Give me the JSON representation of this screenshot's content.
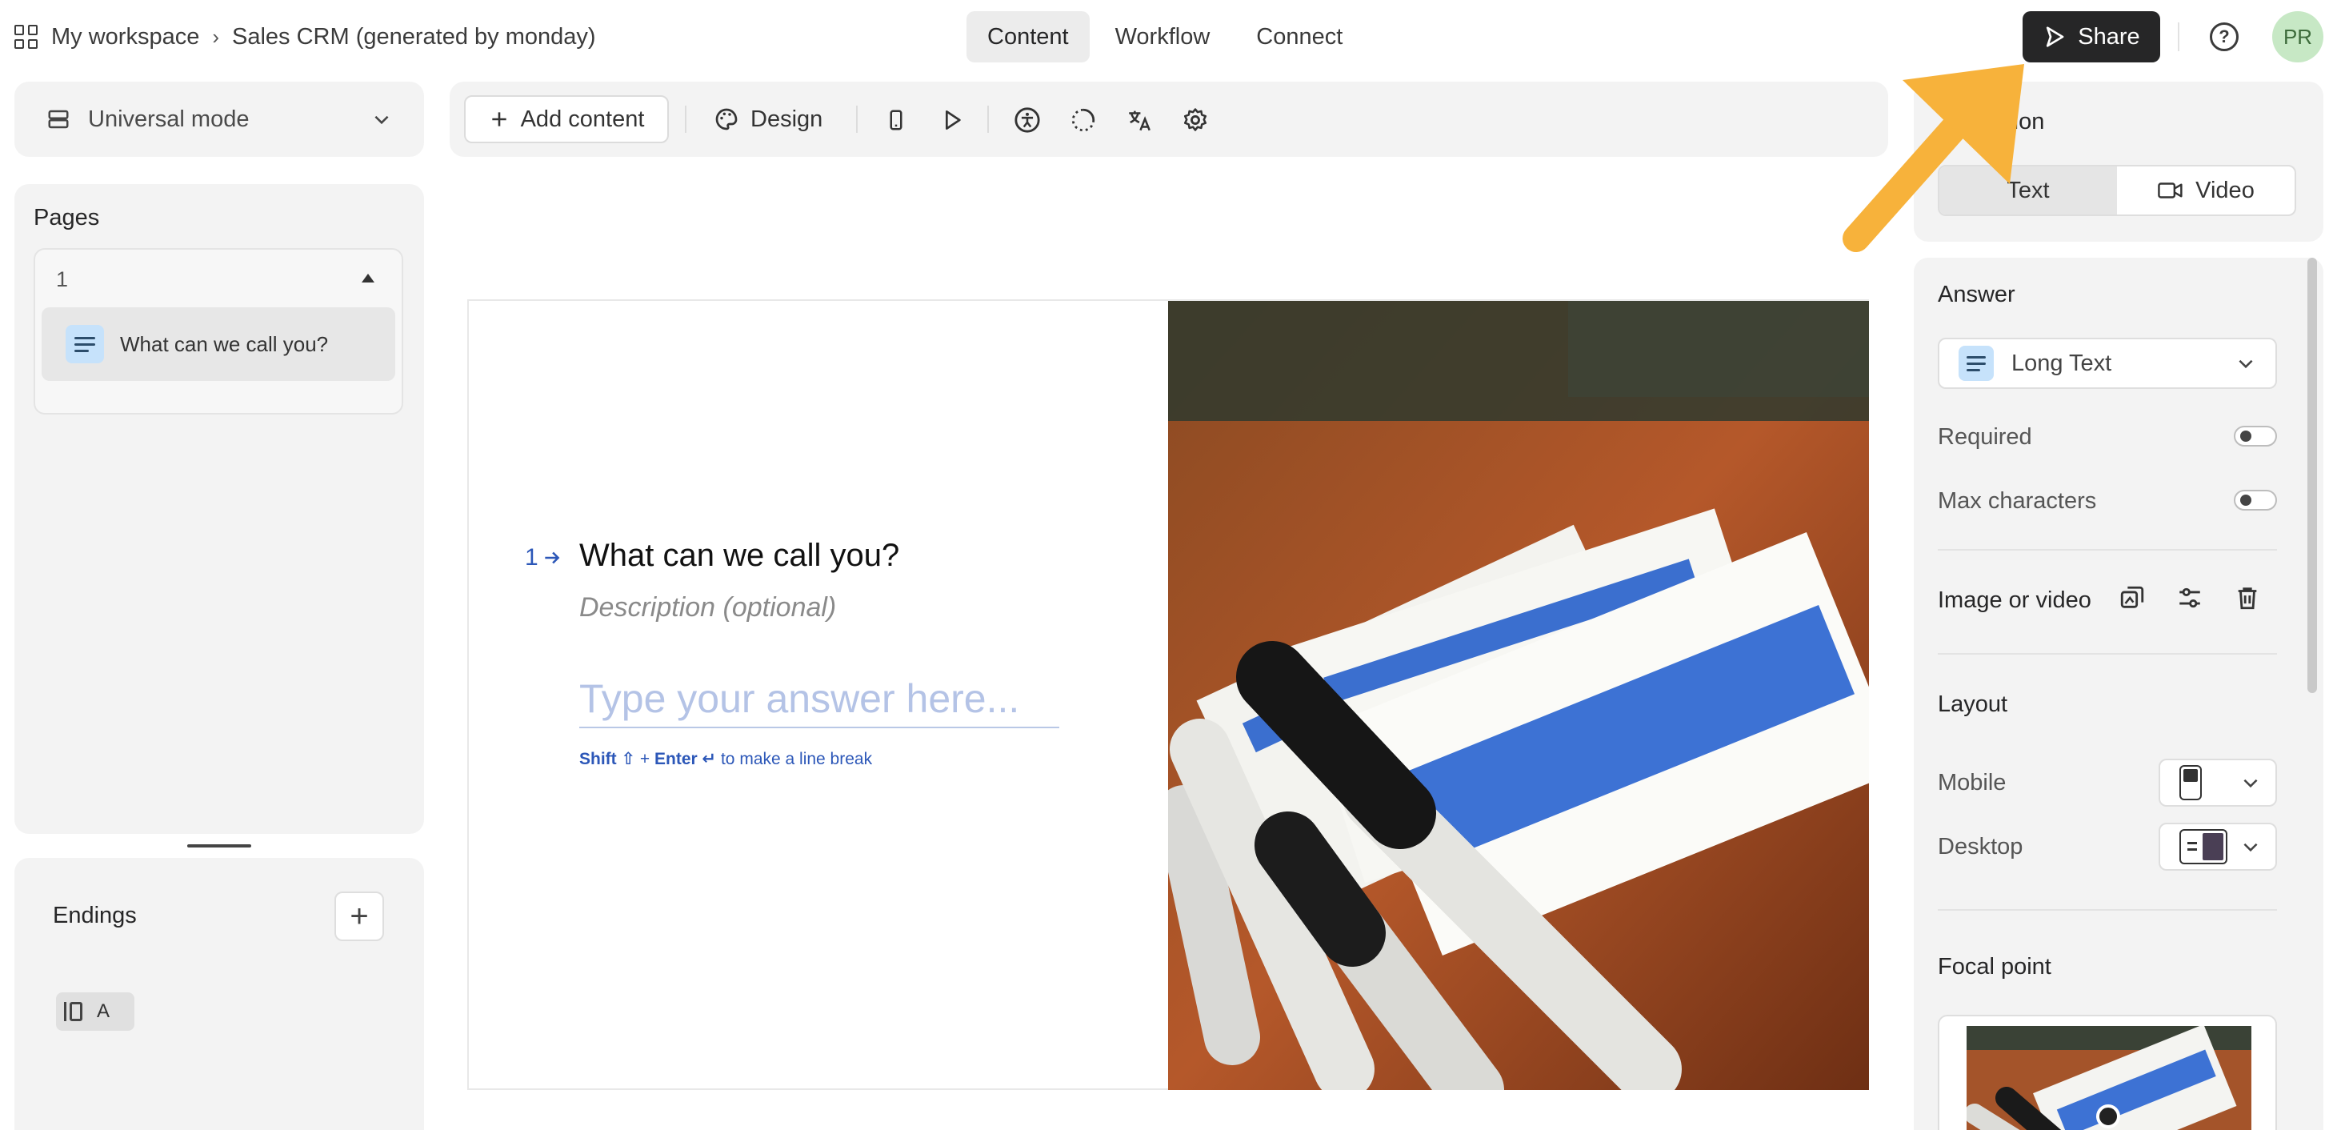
{
  "header": {
    "breadcrumb": [
      "My workspace",
      "Sales CRM (generated by monday)"
    ],
    "tabs": [
      {
        "label": "Content",
        "active": true
      },
      {
        "label": "Workflow",
        "active": false
      },
      {
        "label": "Connect",
        "active": false
      }
    ],
    "share_label": "Share",
    "avatar_initials": "PR"
  },
  "sidebar": {
    "mode_label": "Universal mode",
    "pages_title": "Pages",
    "page_group_number": "1",
    "page_items": [
      {
        "label": "What can we call you?",
        "icon": "long-text-icon"
      }
    ],
    "endings_title": "Endings",
    "ending_items": [
      {
        "label": "A"
      }
    ]
  },
  "toolbar": {
    "add_content_label": "Add content",
    "design_label": "Design",
    "icons": [
      "mobile-preview-icon",
      "play-icon",
      "accessibility-icon",
      "loading-icon",
      "translate-icon",
      "settings-icon"
    ]
  },
  "canvas": {
    "question_number": "1",
    "question_title": "What can we call you?",
    "description_placeholder": "Description (optional)",
    "answer_placeholder": "Type your answer here...",
    "hint_shift": "Shift ⇧",
    "hint_plus": " + ",
    "hint_enter": "Enter ↵",
    "hint_rest": " to make a line break"
  },
  "right_panel": {
    "question_label": "Question",
    "question_label_visible": "estion",
    "question_types": [
      {
        "label": "Text",
        "active": true
      },
      {
        "label": "Video",
        "active": false
      }
    ],
    "answer_title": "Answer",
    "answer_type": "Long Text",
    "required_label": "Required",
    "required_on": false,
    "max_characters_label": "Max characters",
    "max_characters_on": false,
    "image_video_label": "Image or video",
    "layout_title": "Layout",
    "mobile_label": "Mobile",
    "desktop_label": "Desktop",
    "focal_point_title": "Focal point"
  },
  "colors": {
    "share_button": "#262627",
    "accent_blue": "#2c57b8",
    "annotation_arrow": "#f7b23b",
    "avatar_bg": "#c7e8c5"
  }
}
